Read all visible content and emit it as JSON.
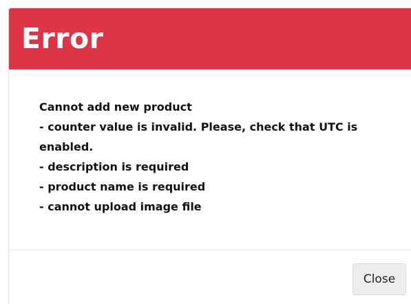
{
  "modal": {
    "title": "Error",
    "header_color": "#dc3545",
    "messages": [
      "Cannot add new product",
      "- counter value is invalid. Please, check that UTC is enabled.",
      "- description is required",
      "- product name is required",
      "- cannot upload image file"
    ],
    "close_label": "Close"
  }
}
